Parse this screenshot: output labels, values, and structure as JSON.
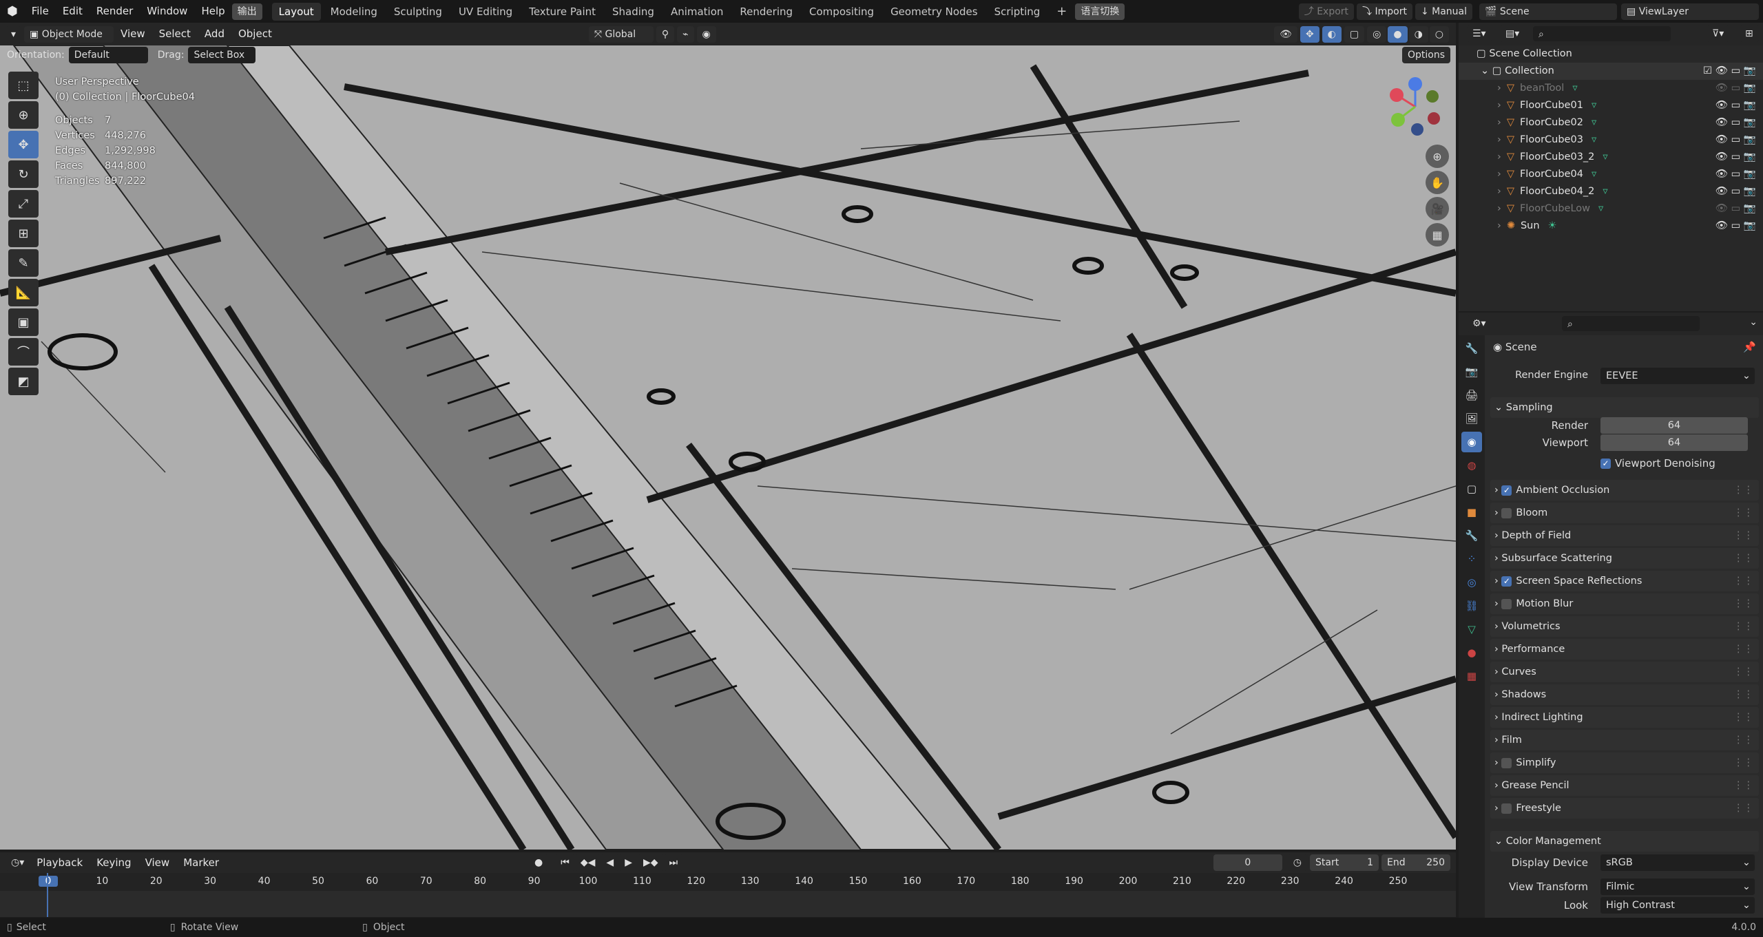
{
  "topbar": {
    "menus": [
      "File",
      "Edit",
      "Render",
      "Window",
      "Help"
    ],
    "output_btn": "输出",
    "workspaces": [
      "Layout",
      "Modeling",
      "Sculpting",
      "UV Editing",
      "Texture Paint",
      "Shading",
      "Animation",
      "Rendering",
      "Compositing",
      "Geometry Nodes",
      "Scripting"
    ],
    "active_workspace": "Layout",
    "lang_btn": "语言切换",
    "export": "Export",
    "import": "Import",
    "manual": "Manual",
    "scene": "Scene",
    "viewlayer": "ViewLayer"
  },
  "viewport_header": {
    "mode": "Object Mode",
    "menus": [
      "View",
      "Select",
      "Add",
      "Object"
    ],
    "transform_orientation": "Global",
    "orientation_label": "Orientation:",
    "orientation_value": "Default",
    "drag_label": "Drag:",
    "drag_value": "Select Box",
    "options": "Options"
  },
  "viewport_info": {
    "view_name": "User Perspective",
    "collection_line": "(0) Collection | FloorCube04",
    "stats": [
      {
        "label": "Objects",
        "value": "7"
      },
      {
        "label": "Vertices",
        "value": "448,276"
      },
      {
        "label": "Edges",
        "value": "1,292,998"
      },
      {
        "label": "Faces",
        "value": "844,800"
      },
      {
        "label": "Triangles",
        "value": "897,222"
      }
    ]
  },
  "outliner": {
    "scene_collection": "Scene Collection",
    "collection": "Collection",
    "items": [
      {
        "name": "beanTool",
        "dim": true
      },
      {
        "name": "FloorCube01",
        "dim": false
      },
      {
        "name": "FloorCube02",
        "dim": false
      },
      {
        "name": "FloorCube03",
        "dim": false
      },
      {
        "name": "FloorCube03_2",
        "dim": false
      },
      {
        "name": "FloorCube04",
        "dim": false
      },
      {
        "name": "FloorCube04_2",
        "dim": false
      },
      {
        "name": "FloorCubeLow",
        "dim": true
      },
      {
        "name": "Sun",
        "dim": false
      }
    ]
  },
  "properties": {
    "context": "Scene",
    "render_engine_label": "Render Engine",
    "render_engine": "EEVEE",
    "sampling": "Sampling",
    "render_label": "Render",
    "render_value": "64",
    "viewport_label": "Viewport",
    "viewport_value": "64",
    "viewport_denoising": "Viewport Denoising",
    "panels": [
      {
        "label": "Ambient Occlusion",
        "checkbox": true,
        "checked": true
      },
      {
        "label": "Bloom",
        "checkbox": true,
        "checked": false
      },
      {
        "label": "Depth of Field",
        "checkbox": false
      },
      {
        "label": "Subsurface Scattering",
        "checkbox": false
      },
      {
        "label": "Screen Space Reflections",
        "checkbox": true,
        "checked": true
      },
      {
        "label": "Motion Blur",
        "checkbox": true,
        "checked": false
      },
      {
        "label": "Volumetrics",
        "checkbox": false
      },
      {
        "label": "Performance",
        "checkbox": false
      },
      {
        "label": "Curves",
        "checkbox": false
      },
      {
        "label": "Shadows",
        "checkbox": false
      },
      {
        "label": "Indirect Lighting",
        "checkbox": false
      },
      {
        "label": "Film",
        "checkbox": false
      },
      {
        "label": "Simplify",
        "checkbox": true,
        "checked": false
      },
      {
        "label": "Grease Pencil",
        "checkbox": false
      },
      {
        "label": "Freestyle",
        "checkbox": true,
        "checked": false
      }
    ],
    "color_management": "Color Management",
    "display_device_label": "Display Device",
    "display_device": "sRGB",
    "view_transform_label": "View Transform",
    "view_transform": "Filmic",
    "look_label": "Look",
    "look": "High Contrast"
  },
  "timeline": {
    "menus": [
      "Playback",
      "Keying",
      "View",
      "Marker"
    ],
    "current_frame": "0",
    "start_label": "Start",
    "start": "1",
    "end_label": "End",
    "end": "250",
    "ticks": [
      "0",
      "10",
      "20",
      "30",
      "40",
      "50",
      "60",
      "70",
      "80",
      "90",
      "100",
      "110",
      "120",
      "130",
      "140",
      "150",
      "160",
      "170",
      "180",
      "190",
      "200",
      "210",
      "220",
      "230",
      "240",
      "250"
    ]
  },
  "statusbar": {
    "select": "Select",
    "rotate": "Rotate View",
    "object": "Object",
    "version": "4.0.0"
  },
  "colors": {
    "accent": "#4772b3",
    "object_orange": "#e08a3c",
    "mesh_green": "#3fbf8f"
  }
}
